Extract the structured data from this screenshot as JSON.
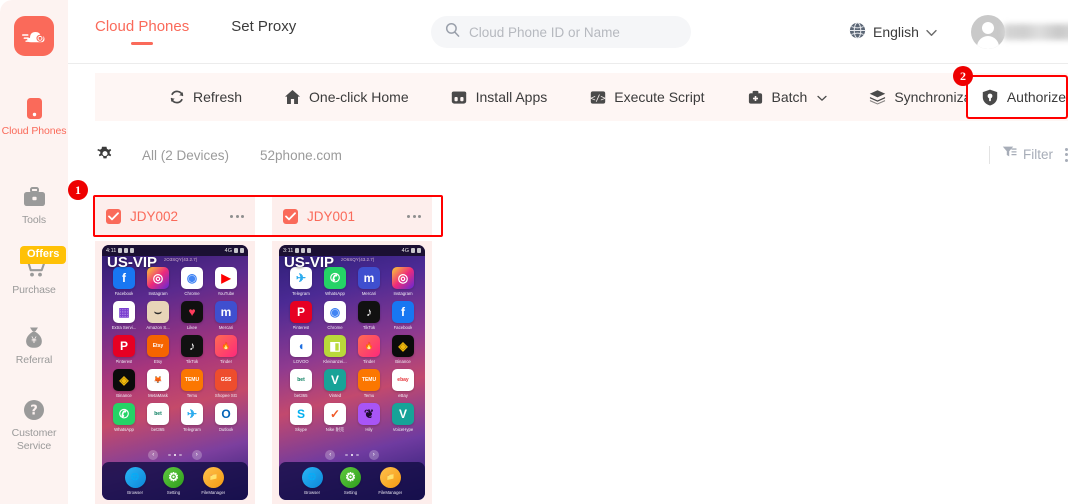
{
  "app": {
    "logo_icon": "cloud-speed-logo"
  },
  "sidebar": {
    "items": [
      {
        "label": "Cloud Phones",
        "icon": "mobile-phone-icon",
        "active": true
      },
      {
        "label": "Tools",
        "icon": "briefcase-icon",
        "active": false
      },
      {
        "label": "Purchase",
        "icon": "shopping-cart-icon",
        "active": false
      },
      {
        "label": "Referral",
        "icon": "money-bag-icon",
        "active": false
      },
      {
        "label": "Customer Service",
        "icon": "question-circle-icon",
        "active": false
      }
    ],
    "offers_badge": "Offers"
  },
  "header": {
    "tabs": [
      {
        "label": "Cloud Phones",
        "active": true
      },
      {
        "label": "Set Proxy",
        "active": false
      }
    ],
    "search": {
      "placeholder": "Cloud Phone ID or Name",
      "value": "",
      "icon": "search-icon"
    },
    "language": {
      "label": "English",
      "icon": "globe-icon",
      "chevron": "chevron-down-icon"
    },
    "account": {
      "avatar_icon": "user-avatar-icon",
      "username": ""
    }
  },
  "toolbar": {
    "buttons": [
      {
        "label": "Refresh",
        "icon": "refresh-icon"
      },
      {
        "label": "One-click Home",
        "icon": "home-icon"
      },
      {
        "label": "Install Apps",
        "icon": "install-apps-icon"
      },
      {
        "label": "Execute Script",
        "icon": "code-script-icon"
      },
      {
        "label": "Batch",
        "icon": "batch-icon",
        "chevron": "chevron-down-icon"
      },
      {
        "label": "Synchronization",
        "icon": "layers-sync-icon"
      }
    ],
    "authorize": {
      "label": "Authorize",
      "icon": "shield-authorize-icon"
    }
  },
  "annotations": [
    {
      "number": "1",
      "target": "device-card-selection"
    },
    {
      "number": "2",
      "target": "authorize-button"
    }
  ],
  "filterbar": {
    "settings_icon": "gear-icon",
    "chips": [
      {
        "label": "All (2 Devices)"
      },
      {
        "label": "52phone.com"
      }
    ],
    "filter": {
      "label": "Filter",
      "icon": "filter-icon"
    },
    "more_icon": "more-vertical-icon"
  },
  "devices": [
    {
      "name": "JDY002",
      "checked": true,
      "more_icon": "more-horizontal-icon",
      "screen": {
        "status_time": "4:11",
        "status_network": "4G",
        "watermark": "US-VIP",
        "version": "zO3SQY(43.2.7)",
        "apps": [
          {
            "name": "Facebook",
            "glyph": "f",
            "bg": "#1877F2",
            "fg": "#ffffff"
          },
          {
            "name": "Instagram",
            "glyph": "◎",
            "bg": "linear-gradient(135deg,#f9ce34,#ee2a7b,#6228d7)",
            "fg": "#ffffff"
          },
          {
            "name": "Chrome",
            "glyph": "◉",
            "bg": "#ffffff",
            "fg": "#4285F4"
          },
          {
            "name": "YouTube",
            "glyph": "▶",
            "bg": "#ffffff",
            "fg": "#FF0000"
          },
          {
            "name": "Extra Servi...",
            "glyph": "▦",
            "bg": "#ffffff",
            "fg": "#7a3fd0"
          },
          {
            "name": "Amazon S...",
            "glyph": "⌣",
            "bg": "#e8d5b8",
            "fg": "#2b2b2b"
          },
          {
            "name": "Likee",
            "glyph": "♥",
            "bg": "#101010",
            "fg": "#ff3b5c"
          },
          {
            "name": "Mercari",
            "glyph": "m",
            "bg": "#3f4fcf",
            "fg": "#ffffff"
          },
          {
            "name": "Pinterest",
            "glyph": "P",
            "bg": "#E60023",
            "fg": "#ffffff"
          },
          {
            "name": "Etsy",
            "glyph": "Etsy",
            "bg": "#F56400",
            "fg": "#ffffff"
          },
          {
            "name": "TikTok",
            "glyph": "♪",
            "bg": "#111111",
            "fg": "#ffffff"
          },
          {
            "name": "Tinder",
            "glyph": "🔥",
            "bg": "linear-gradient(135deg,#ff6b52,#fd297b)",
            "fg": "#ffffff"
          },
          {
            "name": "Binance",
            "glyph": "◈",
            "bg": "#0b0b0b",
            "fg": "#F0B90B"
          },
          {
            "name": "MetaMask",
            "glyph": "🦊",
            "bg": "#ffffff",
            "fg": "#f6851b"
          },
          {
            "name": "Temu",
            "glyph": "TEMU",
            "bg": "#FB7701",
            "fg": "#ffffff"
          },
          {
            "name": "Shopee SG",
            "glyph": "GSS",
            "bg": "#EE4D2D",
            "fg": "#ffffff"
          },
          {
            "name": "WhatsApp",
            "glyph": "✆",
            "bg": "#25D366",
            "fg": "#ffffff"
          },
          {
            "name": "bet365",
            "glyph": "bet",
            "bg": "#ffffff",
            "fg": "#027b5b"
          },
          {
            "name": "Telegram",
            "glyph": "✈",
            "bg": "#ffffff",
            "fg": "#2AABEE"
          },
          {
            "name": "Outlook",
            "glyph": "O",
            "bg": "#ffffff",
            "fg": "#0364B8"
          }
        ],
        "dock": [
          {
            "name": "Browser",
            "glyph": "🌐",
            "bg": "linear-gradient(135deg,#29b6f6,#0d86d8)",
            "fg": "#ffffff"
          },
          {
            "name": "Setting",
            "glyph": "⚙",
            "bg": "linear-gradient(135deg,#5fc93f,#2f9e1d)",
            "fg": "#ffffff"
          },
          {
            "name": "FileManager",
            "glyph": "📁",
            "bg": "linear-gradient(135deg,#ffc14d,#f59b12)",
            "fg": "#ffffff"
          }
        ],
        "pager": {
          "prev": "‹",
          "next": "›",
          "pages": 3,
          "current": 2
        }
      }
    },
    {
      "name": "JDY001",
      "checked": true,
      "more_icon": "more-horizontal-icon",
      "screen": {
        "status_time": "3:11",
        "status_network": "4G",
        "watermark": "US-VIP",
        "version": "zO6SQY(43.2.7)",
        "apps": [
          {
            "name": "Telegram",
            "glyph": "✈",
            "bg": "#ffffff",
            "fg": "#2AABEE"
          },
          {
            "name": "WhatsApp",
            "glyph": "✆",
            "bg": "#25D366",
            "fg": "#ffffff"
          },
          {
            "name": "Mercari",
            "glyph": "m",
            "bg": "#3f4fcf",
            "fg": "#ffffff"
          },
          {
            "name": "Instagram",
            "glyph": "◎",
            "bg": "linear-gradient(135deg,#f9ce34,#ee2a7b,#6228d7)",
            "fg": "#ffffff"
          },
          {
            "name": "Pinterest",
            "glyph": "P",
            "bg": "#E60023",
            "fg": "#ffffff"
          },
          {
            "name": "Chrome",
            "glyph": "◉",
            "bg": "#ffffff",
            "fg": "#4285F4"
          },
          {
            "name": "TikTok",
            "glyph": "♪",
            "bg": "#111111",
            "fg": "#ffffff"
          },
          {
            "name": "Facebook",
            "glyph": "f",
            "bg": "#1877F2",
            "fg": "#ffffff"
          },
          {
            "name": "LOVOO",
            "glyph": "◖",
            "bg": "#ffffff",
            "fg": "#1f6fe0"
          },
          {
            "name": "Kleinanzei...",
            "glyph": "◧",
            "bg": "#b9d93a",
            "fg": "#ffffff"
          },
          {
            "name": "Tinder",
            "glyph": "🔥",
            "bg": "linear-gradient(135deg,#ff6b52,#fd297b)",
            "fg": "#ffffff"
          },
          {
            "name": "Binance",
            "glyph": "◈",
            "bg": "#0b0b0b",
            "fg": "#F0B90B"
          },
          {
            "name": "bet365",
            "glyph": "bet",
            "bg": "#ffffff",
            "fg": "#027b5b"
          },
          {
            "name": "Vinted",
            "glyph": "V",
            "bg": "#17a398",
            "fg": "#ffffff"
          },
          {
            "name": "Temu",
            "glyph": "TEMU",
            "bg": "#FB7701",
            "fg": "#ffffff"
          },
          {
            "name": "eBay",
            "glyph": "ebay",
            "bg": "#ffffff",
            "fg": "#e53238"
          },
          {
            "name": "Skype",
            "glyph": "S",
            "bg": "#ffffff",
            "fg": "#00AFF0"
          },
          {
            "name": "Nike 耐克",
            "glyph": "✓",
            "bg": "#ffffff",
            "fg": "#f05a28"
          },
          {
            "name": "Hily",
            "glyph": "❦",
            "bg": "#a855f7",
            "fg": "#1b0b2e"
          },
          {
            "name": "VoiceHype",
            "glyph": "V",
            "bg": "#17a398",
            "fg": "#ffffff"
          }
        ],
        "dock": [
          {
            "name": "Browser",
            "glyph": "🌐",
            "bg": "linear-gradient(135deg,#29b6f6,#0d86d8)",
            "fg": "#ffffff"
          },
          {
            "name": "Setting",
            "glyph": "⚙",
            "bg": "linear-gradient(135deg,#5fc93f,#2f9e1d)",
            "fg": "#ffffff"
          },
          {
            "name": "FileManager",
            "glyph": "📁",
            "bg": "linear-gradient(135deg,#ffc14d,#f59b12)",
            "fg": "#ffffff"
          }
        ],
        "pager": {
          "prev": "‹",
          "next": "›",
          "pages": 3,
          "current": 2
        }
      }
    }
  ],
  "colors": {
    "brand": "#fa6a5a",
    "sidebar_bg": "#fdf3f1",
    "toolbar_bg": "#fef6f4",
    "card_bg": "#fdeeec",
    "annotation_red": "#ee0000",
    "offers_yellow": "#ffc107"
  }
}
